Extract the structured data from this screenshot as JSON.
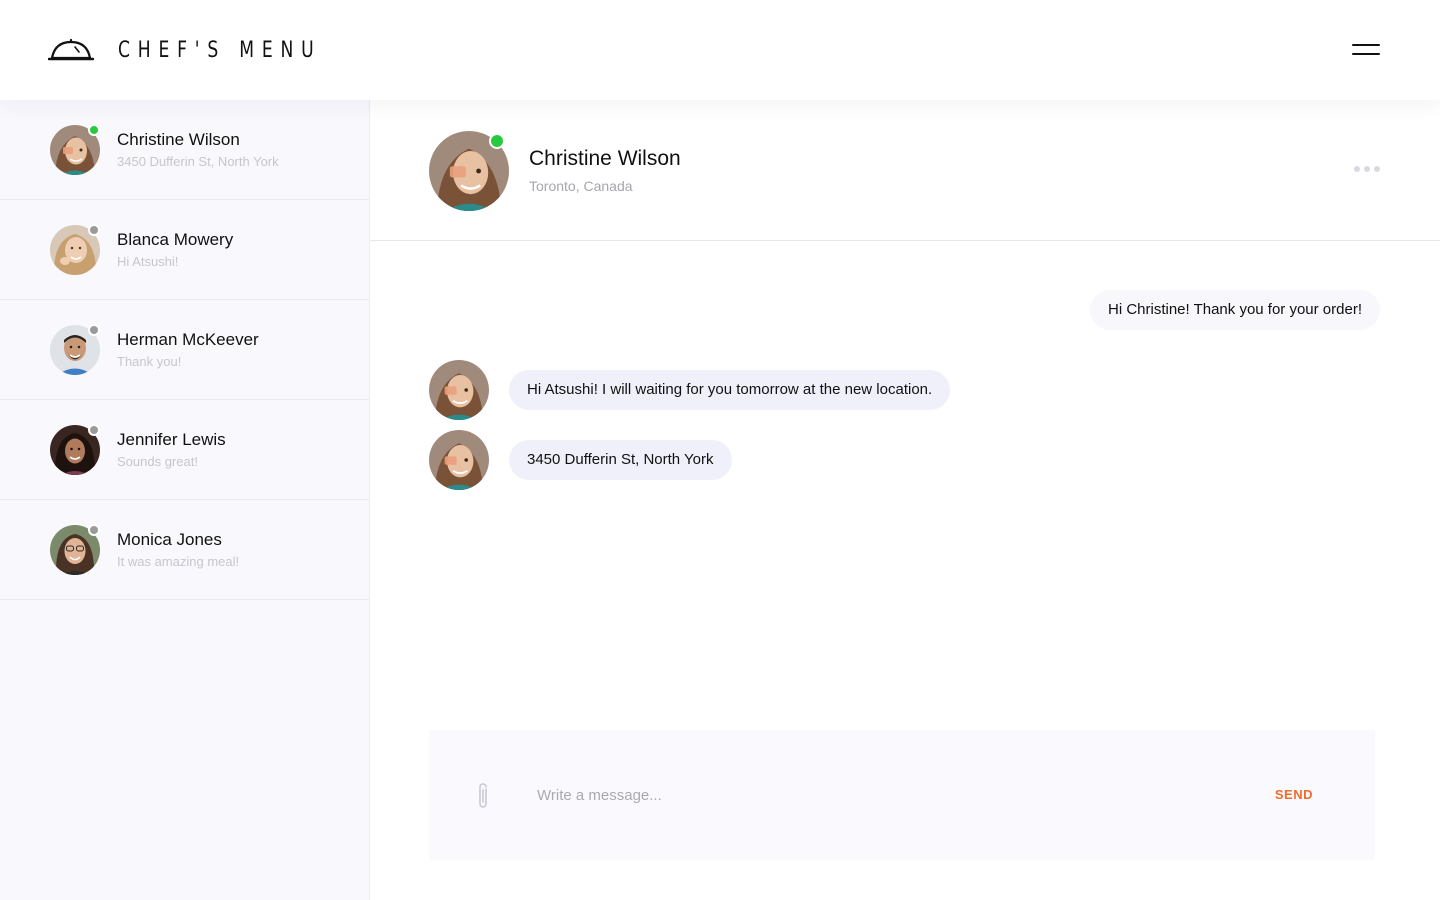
{
  "app": {
    "title": "CHEF'S MENU"
  },
  "colors": {
    "accent": "#f26b2c",
    "online": "#27c93f",
    "offline": "#9a9a9a",
    "sidebar_bg": "#f8f8fd",
    "incoming_bubble": "#f0f0fa"
  },
  "icons": {
    "logo": "cloche-icon",
    "menu": "hamburger-menu-icon",
    "more": "more-dots-icon",
    "attach": "paperclip-icon"
  },
  "sidebar": {
    "contacts": [
      {
        "name": "Christine Wilson",
        "preview": "3450 Dufferin St, North York",
        "status": "online"
      },
      {
        "name": "Blanca Mowery",
        "preview": "Hi Atsushi!",
        "status": "offline"
      },
      {
        "name": "Herman McKeever",
        "preview": "Thank you!",
        "status": "offline"
      },
      {
        "name": "Jennifer Lewis",
        "preview": "Sounds great!",
        "status": "offline"
      },
      {
        "name": "Monica Jones",
        "preview": "It was amazing meal!",
        "status": "offline"
      }
    ]
  },
  "chat": {
    "name": "Christine Wilson",
    "location": "Toronto, Canada",
    "status": "online",
    "messages": [
      {
        "direction": "outgoing",
        "text": "Hi Christine! Thank you for your order!"
      },
      {
        "direction": "incoming",
        "text": "Hi Atsushi! I will waiting for you tomorrow at the new location."
      },
      {
        "direction": "incoming",
        "text": "3450 Dufferin St, North York"
      }
    ]
  },
  "composer": {
    "placeholder": "Write a message...",
    "send_label": "SEND"
  }
}
